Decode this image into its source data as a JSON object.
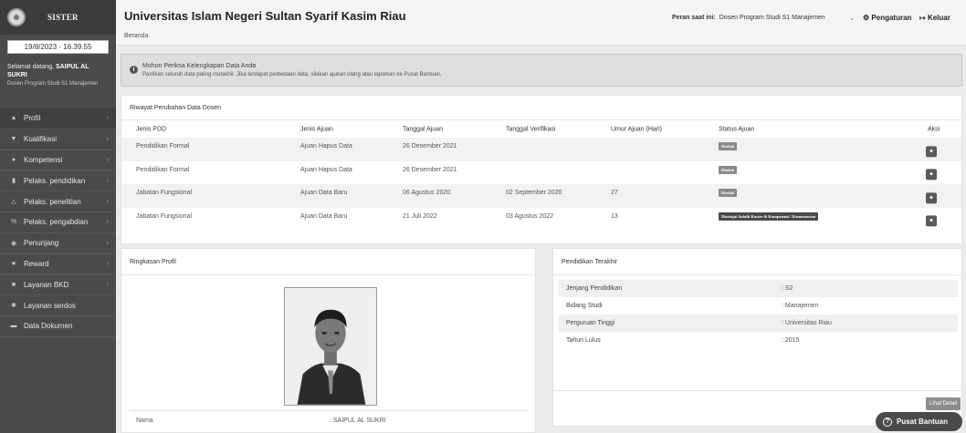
{
  "sidebar": {
    "brand": "SISTER",
    "datetime": "19/8/2023 - 16.39.55",
    "greeting_prefix": "Selamat datang, ",
    "user_name": "SAIPUL AL SUKRI",
    "user_role": "Dosen Program Studi S1 Manajemen",
    "items": [
      {
        "label": "Profil",
        "icon": "user-icon",
        "chevron": true
      },
      {
        "label": "Kualifikasi",
        "icon": "graduation-cap-icon",
        "chevron": true
      },
      {
        "label": "Kompetensi",
        "icon": "users-icon",
        "chevron": true
      },
      {
        "label": "Pelaks. pendidikan",
        "icon": "book-icon",
        "chevron": true
      },
      {
        "label": "Pelaks. penelitian",
        "icon": "flask-icon",
        "chevron": true
      },
      {
        "label": "Pelaks. pengabdian",
        "icon": "percent-icon",
        "chevron": true
      },
      {
        "label": "Penunjang",
        "icon": "circle-icon",
        "chevron": true
      },
      {
        "label": "Reward",
        "icon": "trophy-icon",
        "chevron": true
      },
      {
        "label": "Layanan BKD",
        "icon": "car-icon",
        "chevron": true
      },
      {
        "label": "Layanan serdos",
        "icon": "gear-icon",
        "chevron": false
      },
      {
        "label": "Data Dokumen",
        "icon": "folder-icon",
        "chevron": false
      }
    ]
  },
  "header": {
    "title": "Universitas Islam Negeri Sultan Syarif Kasim Riau",
    "breadcrumb": "Beranda",
    "role_label": "Peran saat ini:",
    "role_value": "Dosen Program Studi S1 Manajemen",
    "settings_label": "Pengaturan",
    "logout_label": "Keluar"
  },
  "alert": {
    "title": "Mohon Periksa Kelengkapan Data Anda",
    "body": "Pastikan seluruh data paling mutakhir. Jika terdapat perbedaan data, silakan ajukan ulang atau laporkan ke Pusat Bantuan."
  },
  "riwayat": {
    "title": "Riwayat Perubahan Data Dosen",
    "columns": [
      "Jenis PDD",
      "Jenis Ajuan",
      "Tanggal Ajuan",
      "Tanggal Verifikasi",
      "Umur Ajuan (Hari)",
      "Status Ajuan",
      "Aksi"
    ],
    "rows": [
      {
        "jenis_pdd": "Pendidikan Formal",
        "jenis_ajuan": "Ajuan Hapus Data",
        "tgl_ajuan": "26 Desember 2021",
        "tgl_verifikasi": "",
        "umur": "",
        "status": "Ditolak"
      },
      {
        "jenis_pdd": "Pendidikan Formal",
        "jenis_ajuan": "Ajuan Hapus Data",
        "tgl_ajuan": "26 Desember 2021",
        "tgl_verifikasi": "",
        "umur": "",
        "status": "Ditolak"
      },
      {
        "jenis_pdd": "Jabatan Fungsional",
        "jenis_ajuan": "Ajuan Data Baru",
        "tgl_ajuan": "06 Agustus 2020",
        "tgl_verifikasi": "02 September 2020",
        "umur": "27",
        "status": "Ditolak"
      },
      {
        "jenis_pdd": "Jabatan Fungsional",
        "jenis_ajuan": "Ajuan Data Baru",
        "tgl_ajuan": "21 Juli 2022",
        "tgl_verifikasi": "03 Agustus 2022",
        "umur": "13",
        "status": "Disetujui Subdit Karier & Kompetensi / Kementerian"
      }
    ]
  },
  "profil": {
    "title": "Ringkasan Profil",
    "name_label": "Nama",
    "name_value": ":   SAIPUL AL SUKRI"
  },
  "pendidikan": {
    "title": "Pendidikan Terakhir",
    "rows": [
      {
        "label": "Jenjang Pendidikan",
        "value": ":   S2"
      },
      {
        "label": "Bidang Studi",
        "value": ":   Manajemen"
      },
      {
        "label": "Perguruan Tinggi",
        "value": ":   Universitas Riau"
      },
      {
        "label": "Tahun Lulus",
        "value": ":   2015"
      }
    ],
    "detail_button": "Lihat Detail"
  },
  "help": {
    "label": "Pusat Bantuan"
  }
}
